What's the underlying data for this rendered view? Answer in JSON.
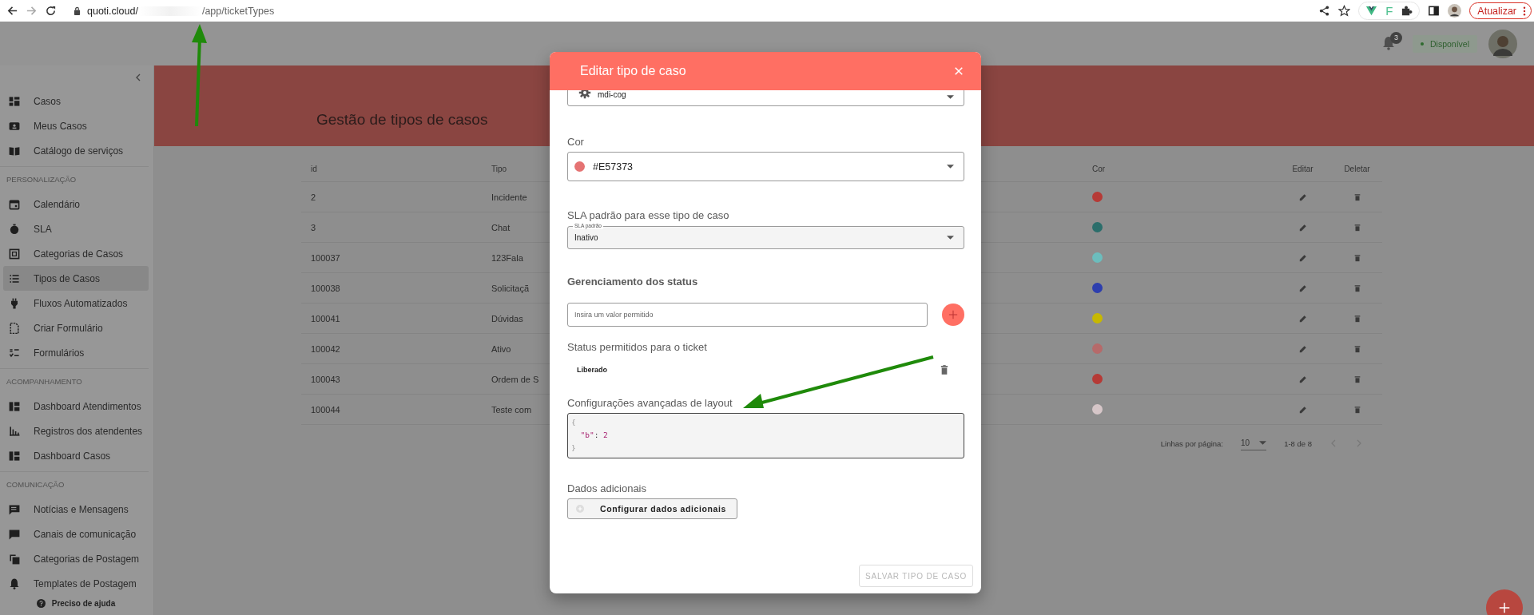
{
  "browser": {
    "url_host": "quoti.cloud/",
    "url_path": "/app/ticketTypes",
    "extension_letter": "F",
    "update_button": "Atualizar"
  },
  "app_header": {
    "notification_count": "3",
    "status": "Disponível"
  },
  "sidebar": {
    "sections": [
      {
        "items": [
          {
            "label": "Casos",
            "selected": false
          },
          {
            "label": "Meus Casos",
            "selected": false
          },
          {
            "label": "Catálogo de serviços",
            "selected": false
          }
        ]
      },
      {
        "heading": "PERSONALIZAÇÃO",
        "items": [
          {
            "label": "Calendário",
            "selected": false
          },
          {
            "label": "SLA",
            "selected": false
          },
          {
            "label": "Categorias de Casos",
            "selected": false
          },
          {
            "label": "Tipos de Casos",
            "selected": true
          },
          {
            "label": "Fluxos Automatizados",
            "selected": false
          },
          {
            "label": "Criar Formulário",
            "selected": false
          },
          {
            "label": "Formulários",
            "selected": false
          }
        ]
      },
      {
        "heading": "ACOMPANHAMENTO",
        "items": [
          {
            "label": "Dashboard Atendimentos",
            "selected": false
          },
          {
            "label": "Registros dos atendentes",
            "selected": false
          },
          {
            "label": "Dashboard Casos",
            "selected": false
          }
        ]
      },
      {
        "heading": "COMUNICAÇÃO",
        "items": [
          {
            "label": "Notícias e Mensagens",
            "selected": false
          },
          {
            "label": "Canais de comunicação",
            "selected": false
          },
          {
            "label": "Categorias de Postagem",
            "selected": false
          },
          {
            "label": "Templates de Postagem",
            "selected": false
          }
        ]
      }
    ],
    "help": "Preciso de ajuda"
  },
  "page": {
    "title": "Gestão de tipos de casos",
    "table": {
      "columns": [
        "id",
        "Tipo",
        "Cor",
        "Editar",
        "Deletar"
      ],
      "rows": [
        {
          "id": "2",
          "tipo": "Incidente",
          "color": "#b63a36"
        },
        {
          "id": "3",
          "tipo": "Chat",
          "color": "#2b6e6b"
        },
        {
          "id": "100037",
          "tipo": "123Fala",
          "color": "#6cbdbd"
        },
        {
          "id": "100038",
          "tipo": "Solicitaçã",
          "color": "#2d3eae"
        },
        {
          "id": "100041",
          "tipo": "Dúvidas",
          "color": "#c7b800"
        },
        {
          "id": "100042",
          "tipo": "Ativo",
          "color": "#b66a6a"
        },
        {
          "id": "100043",
          "tipo": "Ordem de S",
          "color": "#b63a36"
        },
        {
          "id": "100044",
          "tipo": "Teste com",
          "color": "#d6c6c8"
        }
      ],
      "pagination": {
        "rows_per_page_label": "Linhas por página:",
        "rows_per_page": "10",
        "range": "1-8 de 8"
      }
    }
  },
  "modal": {
    "title": "Editar tipo de caso",
    "icon_select": {
      "value": "mdi-cog"
    },
    "color_field": {
      "label": "Cor",
      "value": "#E57373",
      "color": "#e57373"
    },
    "sla": {
      "heading": "SLA padrão para esse tipo de caso",
      "label": "SLA padrão",
      "value": "Inativo"
    },
    "status_management": {
      "heading": "Gerenciamento dos status",
      "placeholder": "Insira um valor permitido"
    },
    "allowed_status": {
      "heading": "Status permitidos para o ticket",
      "items": [
        "Liberado"
      ]
    },
    "layout_config": {
      "heading": "Configurações avançadas de layout",
      "lines": [
        {
          "kind": "brace",
          "text": "{"
        },
        {
          "kind": "pair",
          "key": "\"b\"",
          "separator": ":",
          "value": "2"
        },
        {
          "kind": "brace",
          "text": "}"
        }
      ]
    },
    "additional_data": {
      "heading": "Dados adicionais",
      "button": "Configurar dados adicionais"
    },
    "save_button": {
      "label": "SALVAR TIPO DE CASO",
      "disabled": true
    }
  }
}
